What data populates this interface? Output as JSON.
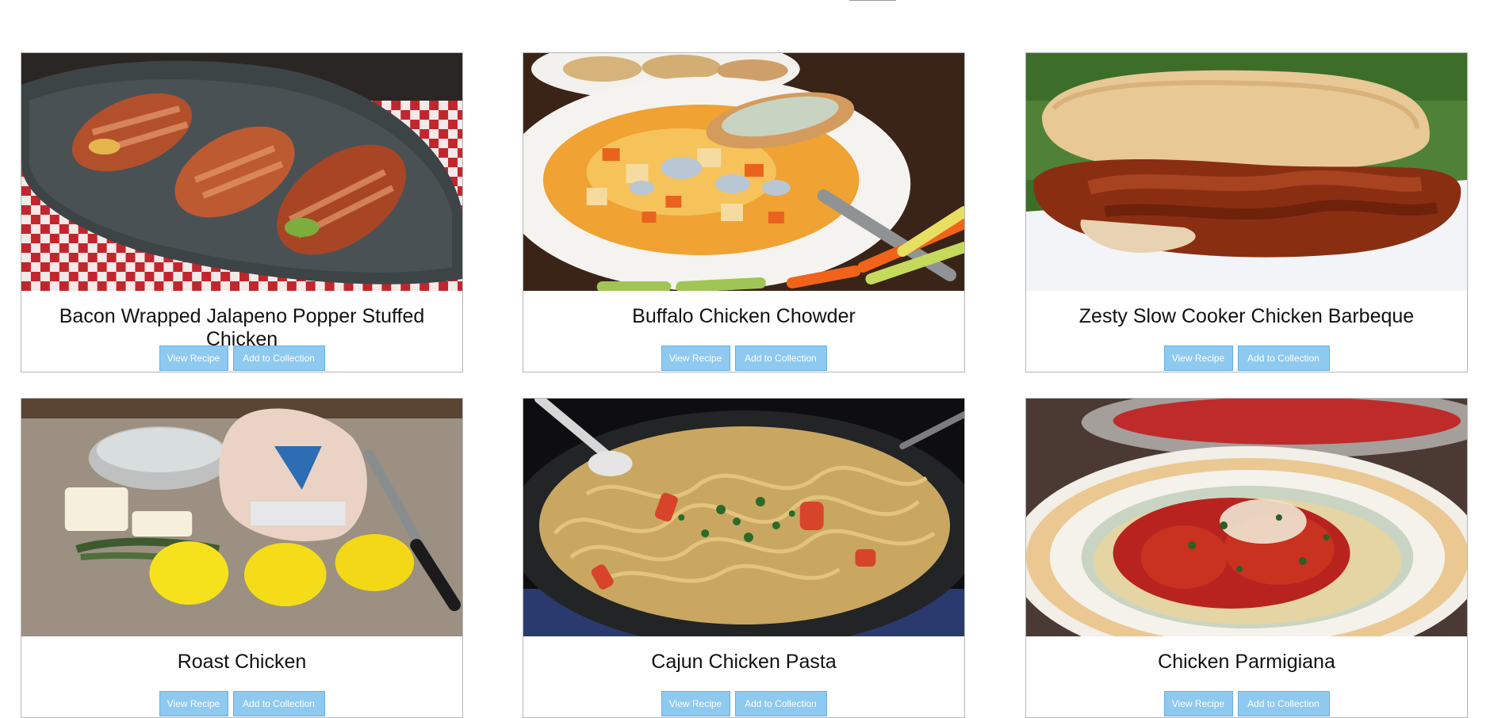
{
  "buttons": {
    "view_label": "View Recipe",
    "add_label": "Add to Collection"
  },
  "recipes": [
    {
      "title": "Bacon Wrapped Jalapeno Popper Stuffed Chicken",
      "image_icon": "bacon-chicken-photo"
    },
    {
      "title": "Buffalo Chicken Chowder",
      "image_icon": "chowder-photo"
    },
    {
      "title": "Zesty Slow Cooker Chicken Barbeque",
      "image_icon": "bbq-sandwich-photo"
    },
    {
      "title": "Roast Chicken",
      "image_icon": "roast-chicken-photo"
    },
    {
      "title": "Cajun Chicken Pasta",
      "image_icon": "cajun-pasta-photo"
    },
    {
      "title": "Chicken Parmigiana",
      "image_icon": "parmigiana-photo"
    }
  ],
  "colors": {
    "button_bg": "#8ec9f0",
    "button_border": "#6aaee0",
    "card_border": "#b5b5b5"
  }
}
